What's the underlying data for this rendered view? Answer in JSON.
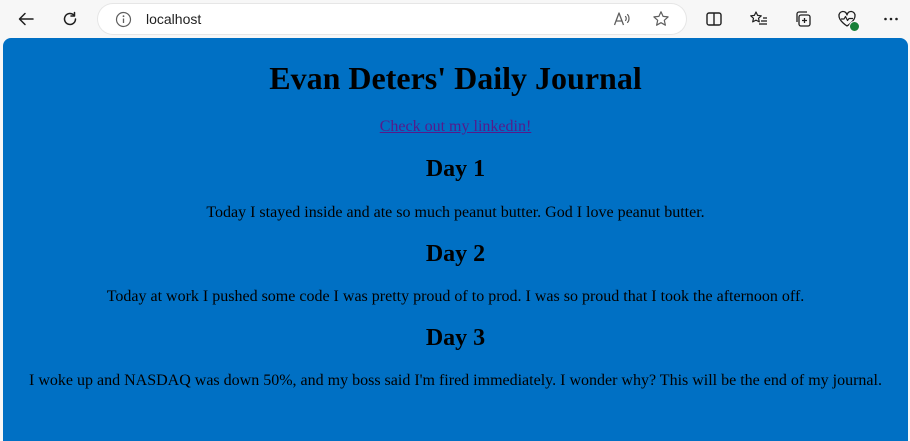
{
  "browser": {
    "url": "localhost",
    "icons": {
      "back": "back-arrow-icon",
      "refresh": "refresh-icon",
      "info": "site-info-icon",
      "read_aloud": "read-aloud-icon",
      "favorite": "favorite-star-icon",
      "split_screen": "split-screen-icon",
      "favorites_list": "favorites-list-icon",
      "collections": "collections-icon",
      "health": "browser-essentials-icon",
      "more": "more-menu-icon"
    }
  },
  "page": {
    "background": "#0070c4",
    "title": "Evan Deters' Daily Journal",
    "link_text": "Check out my linkedin!",
    "entries": [
      {
        "heading": "Day 1",
        "text": "Today I stayed inside and ate so much peanut butter. God I love peanut butter."
      },
      {
        "heading": "Day 2",
        "text": "Today at work I pushed some code I was pretty proud of to prod. I was so proud that I took the afternoon off."
      },
      {
        "heading": "Day 3",
        "text": "I woke up and NASDAQ was down 50%, and my boss said I'm fired immediately. I wonder why? This will be the end of my journal."
      }
    ]
  }
}
